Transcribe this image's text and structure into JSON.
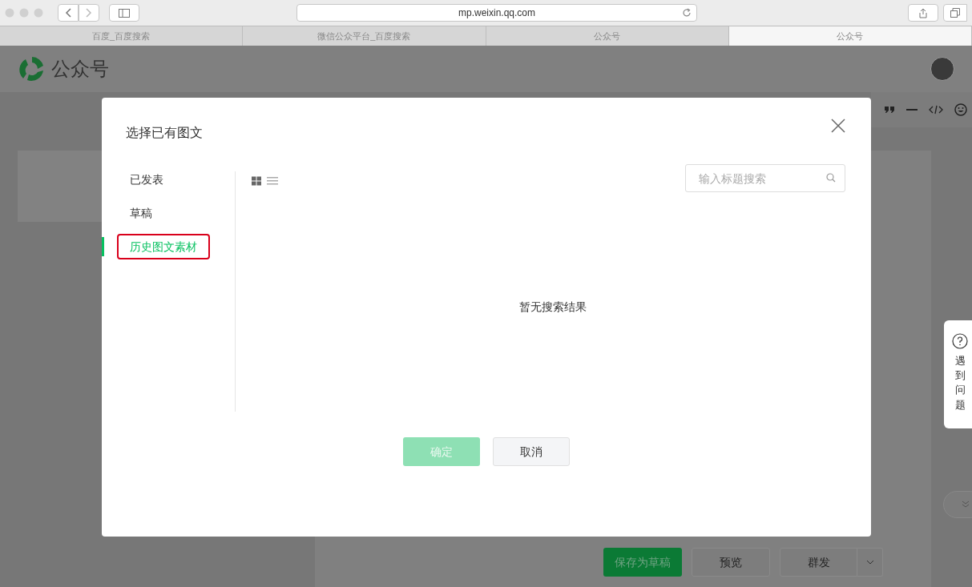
{
  "browser": {
    "url": "mp.weixin.qq.com",
    "tabs": [
      {
        "label": "百度_百度搜索",
        "selected": false
      },
      {
        "label": "微信公众平台_百度搜索",
        "selected": false
      },
      {
        "label": "公众号",
        "selected": false
      },
      {
        "label": "公众号",
        "selected": true
      }
    ]
  },
  "page": {
    "logo_text": "公众号",
    "help_label": "遇到问题",
    "footer_buttons": [
      {
        "label": "保存为草稿",
        "kind": "primary"
      },
      {
        "label": "预览",
        "kind": "plain"
      },
      {
        "label": "群发",
        "kind": "split"
      }
    ]
  },
  "dialog": {
    "title": "选择已有图文",
    "nav": [
      {
        "label": "已发表",
        "selected": false,
        "highlighted": false
      },
      {
        "label": "草稿",
        "selected": false,
        "highlighted": false
      },
      {
        "label": "历史图文素材",
        "selected": true,
        "highlighted": true
      }
    ],
    "view_modes": [
      {
        "kind": "grid",
        "selected": true
      },
      {
        "kind": "list",
        "selected": false
      }
    ],
    "search": {
      "placeholder": "输入标题搜索"
    },
    "empty_text": "暂无搜索结果",
    "buttons": [
      {
        "label": "确定",
        "kind": "primary",
        "disabled": true
      },
      {
        "label": "取消",
        "kind": "secondary",
        "disabled": false
      }
    ]
  }
}
